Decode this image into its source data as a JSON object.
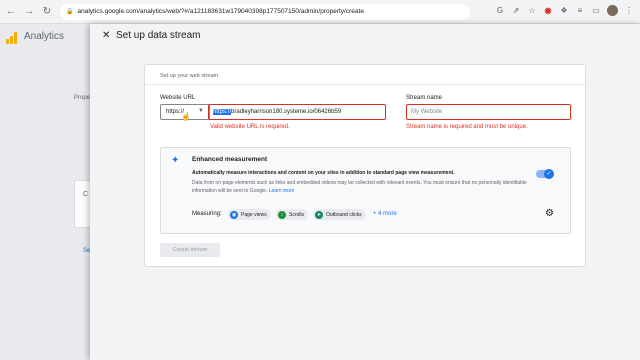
{
  "browser": {
    "url": "analytics.google.com/analytics/web/?#/a121183631w179040398p177507150/admin/property/create",
    "back_icon": "arrow-left",
    "forward_icon": "arrow-right",
    "reload_icon": "reload"
  },
  "app": {
    "title": "Analytics",
    "bg_property_label": "Prope",
    "bg_card_letter": "C",
    "bg_link": "Se"
  },
  "panel": {
    "title": "Set up data stream",
    "close_icon": "close"
  },
  "form": {
    "heading": "Set up your web stream",
    "website_url_label": "Website URL",
    "protocol_value": "https://",
    "url_selected": "https://",
    "url_rest": "bradleyharrison180.systeme.io/06426b59",
    "url_error": "Valid website URL is required.",
    "stream_name_label": "Stream name",
    "stream_name_placeholder": "My Website",
    "stream_name_error": "Stream name is required and must be unique."
  },
  "enhanced": {
    "title": "Enhanced measurement",
    "desc_bold": "Automatically measure interactions and content on your sites in addition to standard page view measurement.",
    "desc": "Data from on-page elements such as links and embedded videos may be collected with relevant events. You must ensure that no personally identifiable information will be sent to Google.",
    "learn_more": "Learn more",
    "toggle_on": true,
    "measuring_label": "Measuring:",
    "chips": [
      {
        "label": "Page views",
        "color": "#1a73e8"
      },
      {
        "label": "Scrolls",
        "color": "#1e8e3e"
      },
      {
        "label": "Outbound clicks",
        "color": "#12846e"
      }
    ],
    "more": "+ 4 more"
  },
  "create_button": "Create stream"
}
